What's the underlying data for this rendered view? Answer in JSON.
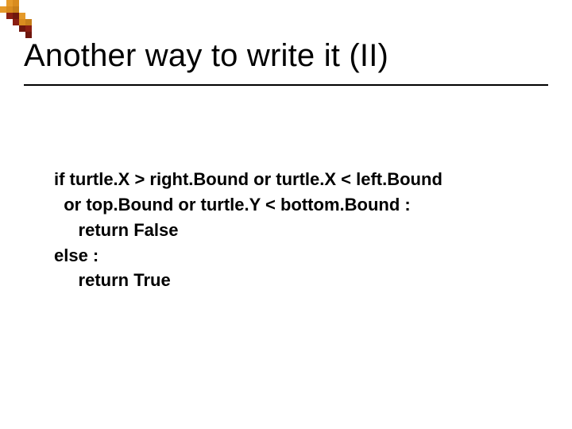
{
  "title": "Another way to write it (II)",
  "code": {
    "l1": "if turtle.X > right.Bound or turtle.X < left.Bound",
    "l2": "  or top.Bound or turtle.Y < bottom.Bound :",
    "l3": "     return False",
    "l4": "else :",
    "l5": "     return True"
  }
}
